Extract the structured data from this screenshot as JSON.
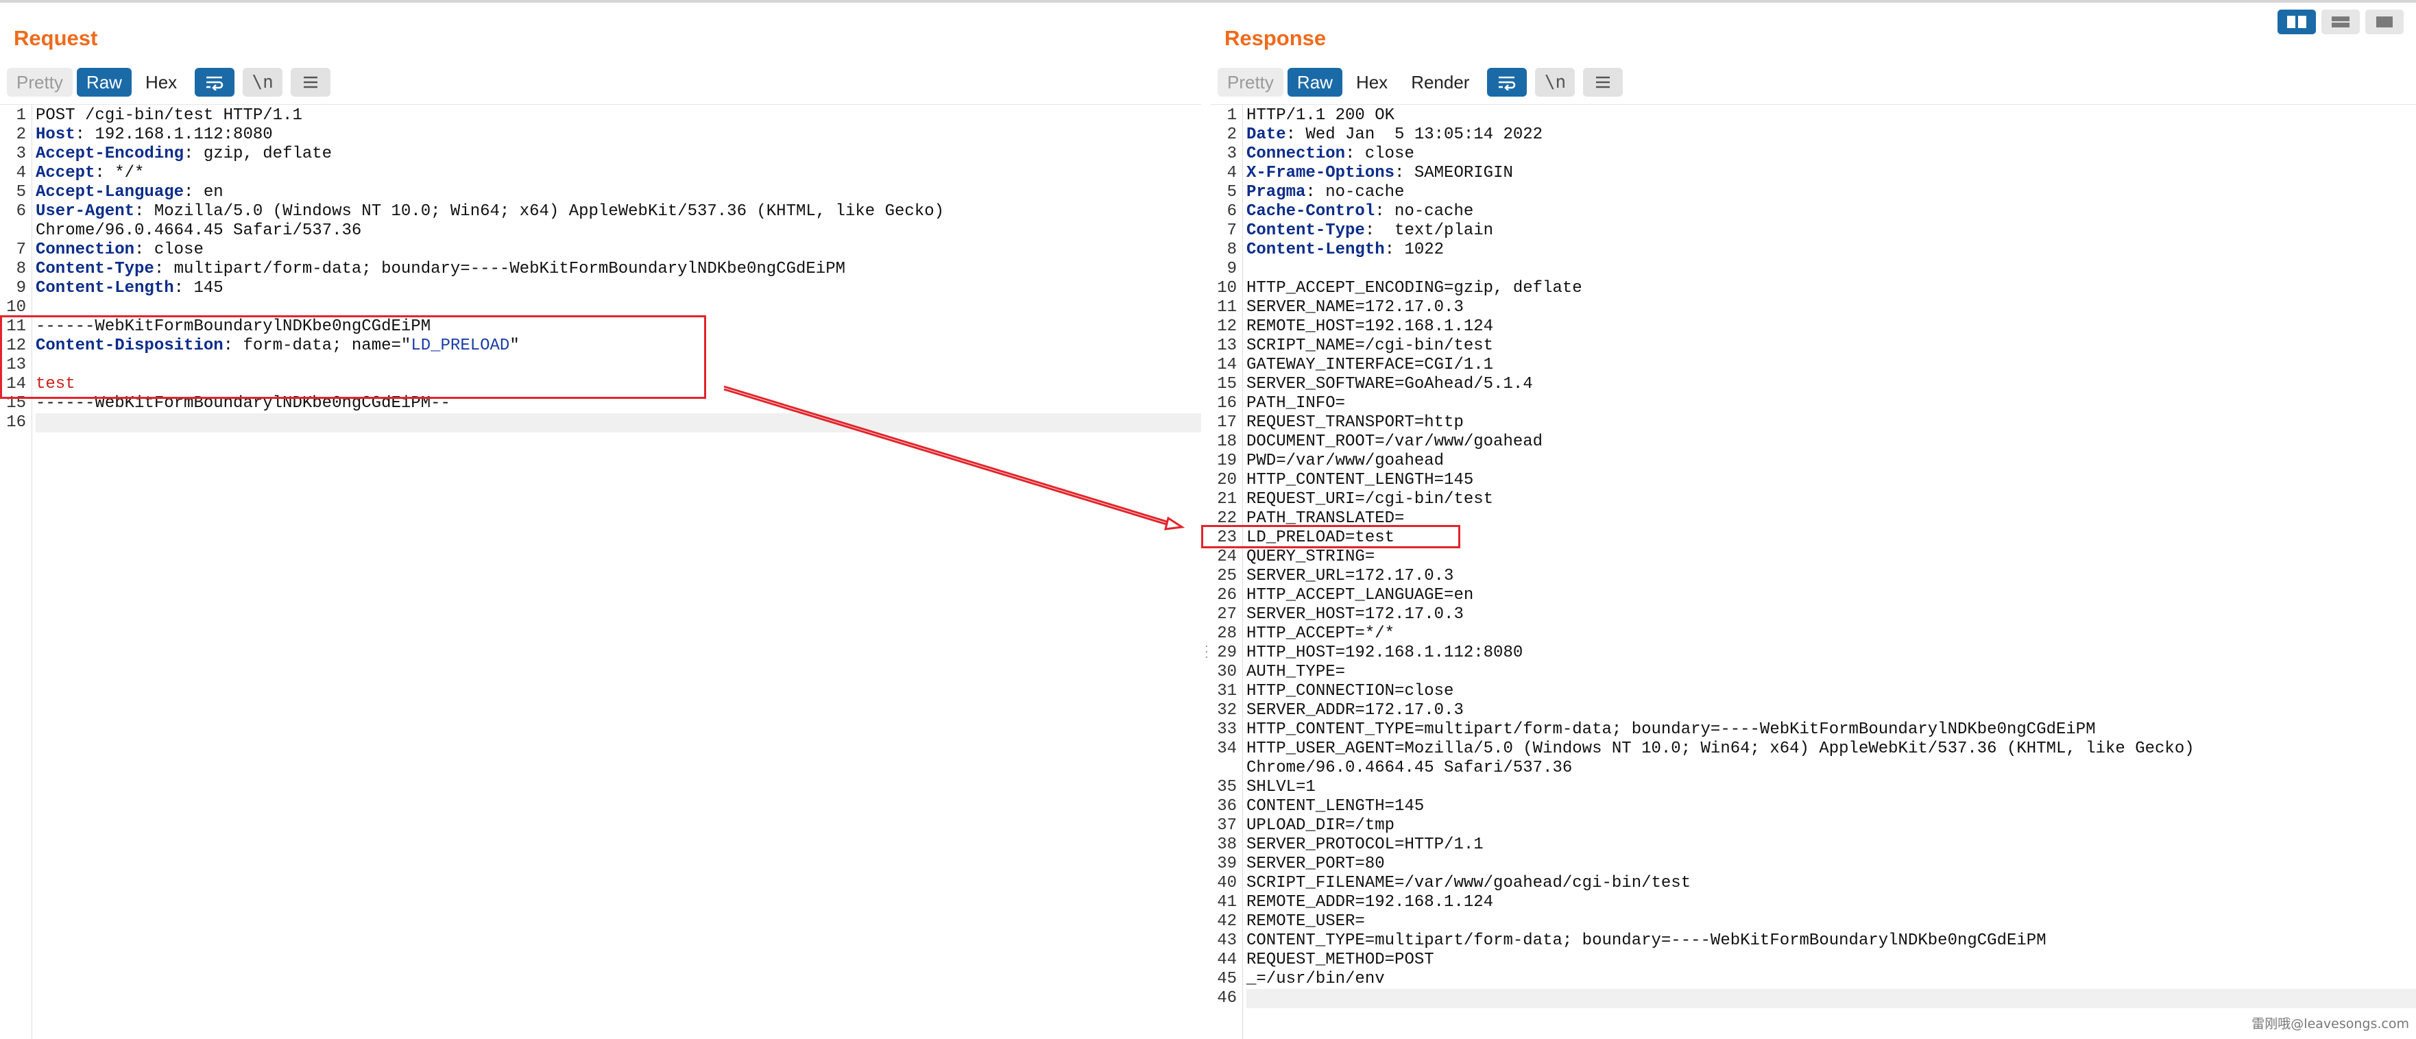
{
  "request": {
    "title": "Request",
    "toolbar": {
      "pretty": "Pretty",
      "raw": "Raw",
      "hex": "Hex",
      "newline_glyph": "\\n"
    },
    "lines": [
      {
        "n": "1",
        "key": "",
        "val": "POST /cgi-bin/test HTTP/1.1"
      },
      {
        "n": "2",
        "key": "Host",
        "val": ": 192.168.1.112:8080"
      },
      {
        "n": "3",
        "key": "Accept-Encoding",
        "val": ": gzip, deflate"
      },
      {
        "n": "4",
        "key": "Accept",
        "val": ": */*"
      },
      {
        "n": "5",
        "key": "Accept-Language",
        "val": ": en"
      },
      {
        "n": "6",
        "key": "User-Agent",
        "val": ": Mozilla/5.0 (Windows NT 10.0; Win64; x64) AppleWebKit/537.36 (KHTML, like Gecko)"
      },
      {
        "n": "",
        "key": "",
        "val": "Chrome/96.0.4664.45 Safari/537.36"
      },
      {
        "n": "7",
        "key": "Connection",
        "val": ": close"
      },
      {
        "n": "8",
        "key": "Content-Type",
        "val": ": multipart/form-data; boundary=----WebKitFormBoundarylNDKbe0ngCGdEiPM"
      },
      {
        "n": "9",
        "key": "Content-Length",
        "val": ": 145"
      },
      {
        "n": "10",
        "key": "",
        "val": ""
      },
      {
        "n": "11",
        "key": "",
        "val": "------WebKitFormBoundarylNDKbe0ngCGdEiPM"
      },
      {
        "n": "12",
        "key": "Content-Disposition",
        "val": ": form-data; name=\"",
        "quoted": "LD_PRELOAD",
        "tail": "\""
      },
      {
        "n": "13",
        "key": "",
        "val": ""
      },
      {
        "n": "14",
        "key": "",
        "val": "",
        "red": "test"
      },
      {
        "n": "15",
        "key": "",
        "val": "------WebKitFormBoundarylNDKbe0ngCGdEiPM--"
      },
      {
        "n": "16",
        "key": "",
        "val": ""
      }
    ]
  },
  "response": {
    "title": "Response",
    "toolbar": {
      "pretty": "Pretty",
      "raw": "Raw",
      "hex": "Hex",
      "render": "Render",
      "newline_glyph": "\\n"
    },
    "lines": [
      {
        "n": "1",
        "key": "",
        "val": "HTTP/1.1 200 OK"
      },
      {
        "n": "2",
        "key": "Date",
        "val": ": Wed Jan  5 13:05:14 2022"
      },
      {
        "n": "3",
        "key": "Connection",
        "val": ": close"
      },
      {
        "n": "4",
        "key": "X-Frame-Options",
        "val": ": SAMEORIGIN"
      },
      {
        "n": "5",
        "key": "Pragma",
        "val": ": no-cache"
      },
      {
        "n": "6",
        "key": "Cache-Control",
        "val": ": no-cache"
      },
      {
        "n": "7",
        "key": "Content-Type",
        "val": ":  text/plain"
      },
      {
        "n": "8",
        "key": "Content-Length",
        "val": ": 1022"
      },
      {
        "n": "9",
        "key": "",
        "val": ""
      },
      {
        "n": "10",
        "key": "",
        "val": "HTTP_ACCEPT_ENCODING=gzip, deflate"
      },
      {
        "n": "11",
        "key": "",
        "val": "SERVER_NAME=172.17.0.3"
      },
      {
        "n": "12",
        "key": "",
        "val": "REMOTE_HOST=192.168.1.124"
      },
      {
        "n": "13",
        "key": "",
        "val": "SCRIPT_NAME=/cgi-bin/test"
      },
      {
        "n": "14",
        "key": "",
        "val": "GATEWAY_INTERFACE=CGI/1.1"
      },
      {
        "n": "15",
        "key": "",
        "val": "SERVER_SOFTWARE=GoAhead/5.1.4"
      },
      {
        "n": "16",
        "key": "",
        "val": "PATH_INFO="
      },
      {
        "n": "17",
        "key": "",
        "val": "REQUEST_TRANSPORT=http"
      },
      {
        "n": "18",
        "key": "",
        "val": "DOCUMENT_ROOT=/var/www/goahead"
      },
      {
        "n": "19",
        "key": "",
        "val": "PWD=/var/www/goahead"
      },
      {
        "n": "20",
        "key": "",
        "val": "HTTP_CONTENT_LENGTH=145"
      },
      {
        "n": "21",
        "key": "",
        "val": "REQUEST_URI=/cgi-bin/test"
      },
      {
        "n": "22",
        "key": "",
        "val": "PATH_TRANSLATED="
      },
      {
        "n": "23",
        "key": "",
        "val": "LD_PRELOAD=test"
      },
      {
        "n": "24",
        "key": "",
        "val": "QUERY_STRING="
      },
      {
        "n": "25",
        "key": "",
        "val": "SERVER_URL=172.17.0.3"
      },
      {
        "n": "26",
        "key": "",
        "val": "HTTP_ACCEPT_LANGUAGE=en"
      },
      {
        "n": "27",
        "key": "",
        "val": "SERVER_HOST=172.17.0.3"
      },
      {
        "n": "28",
        "key": "",
        "val": "HTTP_ACCEPT=*/*"
      },
      {
        "n": "29",
        "key": "",
        "val": "HTTP_HOST=192.168.1.112:8080"
      },
      {
        "n": "30",
        "key": "",
        "val": "AUTH_TYPE="
      },
      {
        "n": "31",
        "key": "",
        "val": "HTTP_CONNECTION=close"
      },
      {
        "n": "32",
        "key": "",
        "val": "SERVER_ADDR=172.17.0.3"
      },
      {
        "n": "33",
        "key": "",
        "val": "HTTP_CONTENT_TYPE=multipart/form-data; boundary=----WebKitFormBoundarylNDKbe0ngCGdEiPM"
      },
      {
        "n": "34",
        "key": "",
        "val": "HTTP_USER_AGENT=Mozilla/5.0 (Windows NT 10.0; Win64; x64) AppleWebKit/537.36 (KHTML, like Gecko)"
      },
      {
        "n": "",
        "key": "",
        "val": "Chrome/96.0.4664.45 Safari/537.36"
      },
      {
        "n": "35",
        "key": "",
        "val": "SHLVL=1"
      },
      {
        "n": "36",
        "key": "",
        "val": "CONTENT_LENGTH=145"
      },
      {
        "n": "37",
        "key": "",
        "val": "UPLOAD_DIR=/tmp"
      },
      {
        "n": "38",
        "key": "",
        "val": "SERVER_PROTOCOL=HTTP/1.1"
      },
      {
        "n": "39",
        "key": "",
        "val": "SERVER_PORT=80"
      },
      {
        "n": "40",
        "key": "",
        "val": "SCRIPT_FILENAME=/var/www/goahead/cgi-bin/test"
      },
      {
        "n": "41",
        "key": "",
        "val": "REMOTE_ADDR=192.168.1.124"
      },
      {
        "n": "42",
        "key": "",
        "val": "REMOTE_USER="
      },
      {
        "n": "43",
        "key": "",
        "val": "CONTENT_TYPE=multipart/form-data; boundary=----WebKitFormBoundarylNDKbe0ngCGdEiPM"
      },
      {
        "n": "44",
        "key": "",
        "val": "REQUEST_METHOD=POST"
      },
      {
        "n": "45",
        "key": "",
        "val": "_=/usr/bin/env"
      },
      {
        "n": "46",
        "key": "",
        "val": ""
      }
    ]
  },
  "colors": {
    "accent_orange": "#ef6a1b",
    "active_blue": "#1b6aa8",
    "highlight_red": "#e3242b"
  },
  "watermark": "雷刚哦@leavesongs.com"
}
